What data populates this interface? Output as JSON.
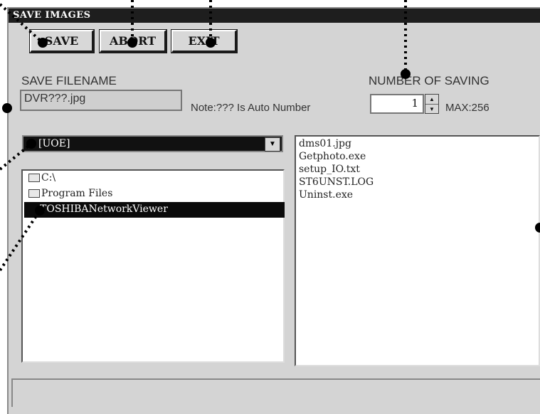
{
  "window": {
    "title": "SAVE IMAGES"
  },
  "toolbar": {
    "save_label": "SAVE",
    "abort_label": "ABORT",
    "exit_label": "EXIT"
  },
  "filename": {
    "label": "SAVE FILENAME",
    "value": "DVR???.jpg",
    "note": "Note:??? Is Auto Number"
  },
  "saving": {
    "label": "NUMBER OF SAVING",
    "value": "1",
    "max": "MAX:256"
  },
  "drive": {
    "selected": "c: [UOE]"
  },
  "tree": {
    "items": [
      "C:\\",
      "Program Files",
      "TOSHIBANetworkViewer"
    ]
  },
  "files": [
    "dms01.jpg",
    "Getphoto.exe",
    "setup_IO.txt",
    "ST6UNST.LOG",
    "Uninst.exe"
  ],
  "colors": {
    "window_bg": "#d4d4d4",
    "titlebar": "#1e1e1e",
    "selection": "#0a0a0a"
  }
}
